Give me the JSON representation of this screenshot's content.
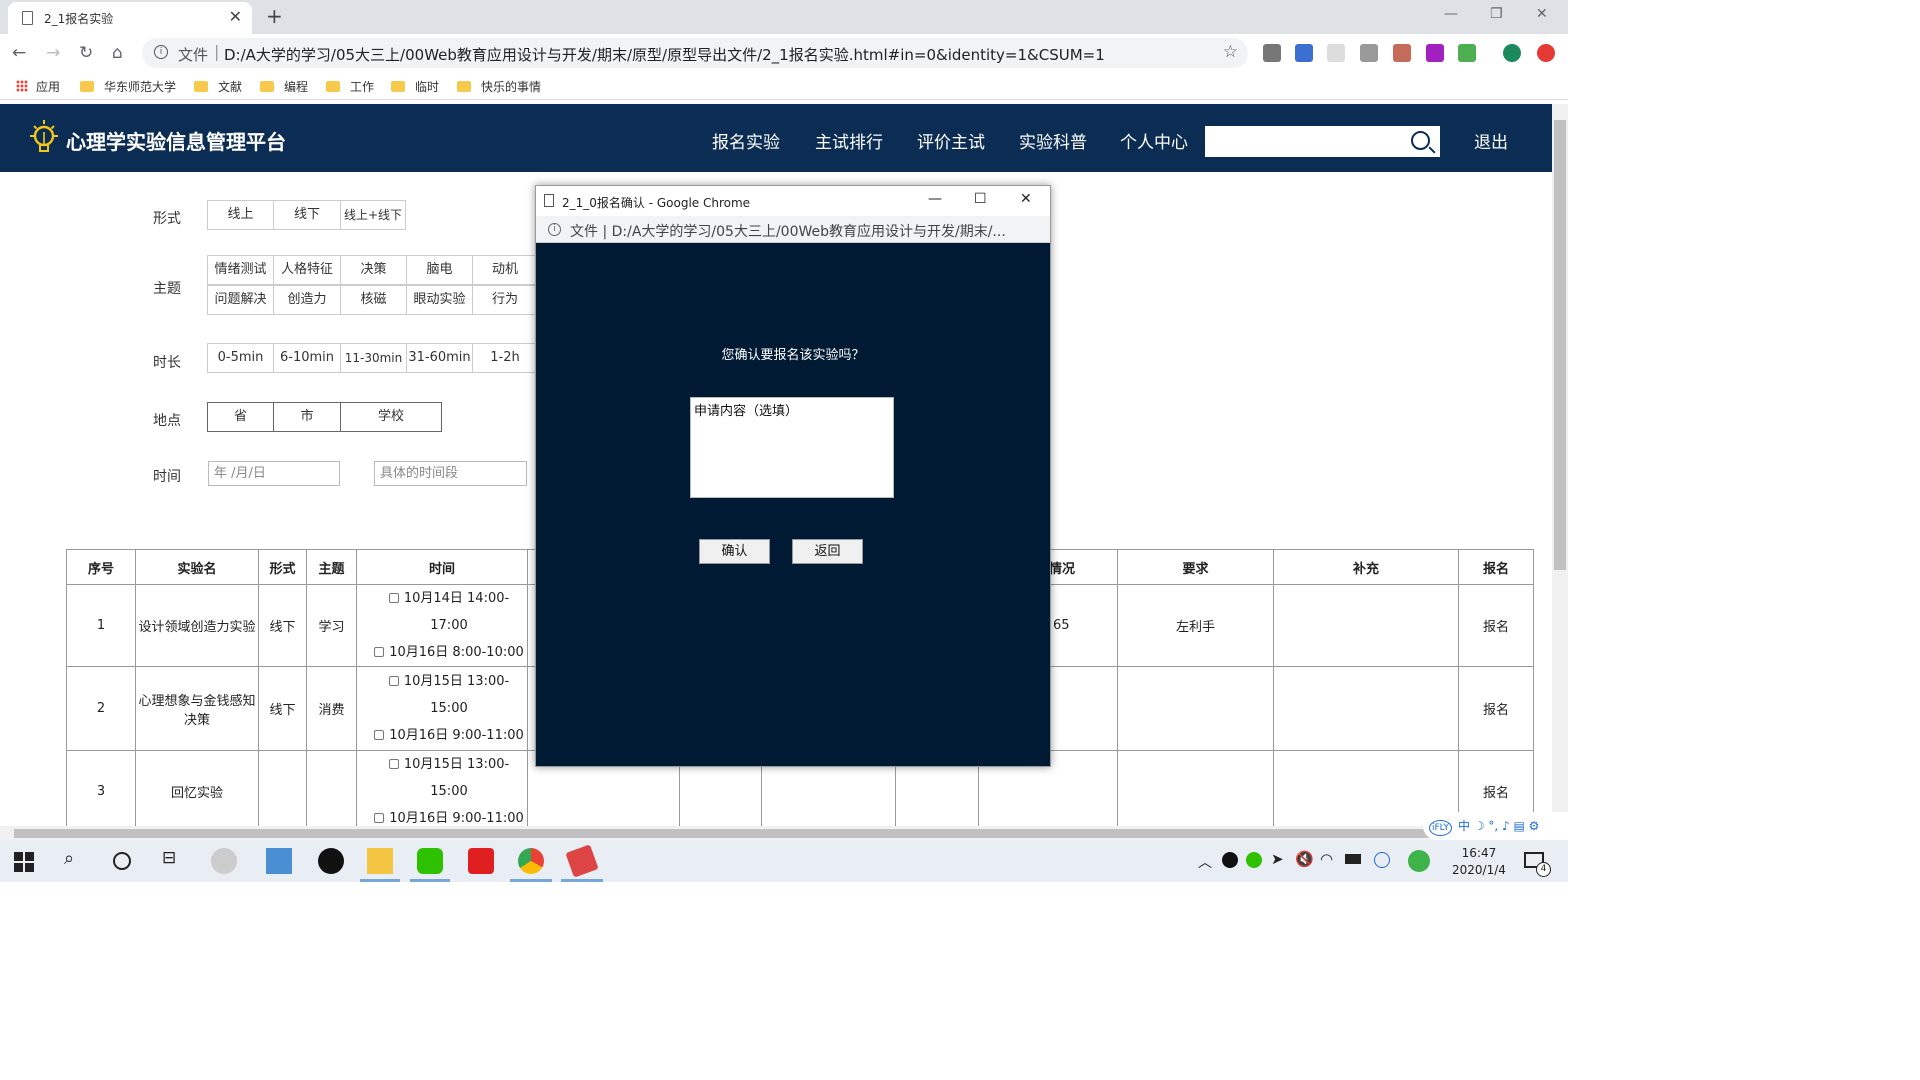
{
  "browser": {
    "tab_title": "2_1报名实验",
    "new_tab": "+",
    "url_prefix": "文件",
    "url": "D:/A大学的学习/05大三上/00Web教育应用设计与开发/期末/原型/原型导出文件/2_1报名实验.html#in=0&identity=1&CSUM=1",
    "bookmarks": [
      "应用",
      "华东师范大学",
      "文献",
      "编程",
      "工作",
      "临时",
      "快乐的事情"
    ]
  },
  "header": {
    "brand": "心理学实验信息管理平台",
    "nav": [
      "报名实验",
      "主试排行",
      "评价主试",
      "实验科普",
      "个人中心"
    ],
    "logout": "退出"
  },
  "filters": {
    "form_label": "形式",
    "form_opts": [
      "线上",
      "线下",
      "线上+线下"
    ],
    "theme_label": "主题",
    "theme_row1": [
      "情绪测试",
      "人格特征",
      "决策",
      "脑电",
      "动机"
    ],
    "theme_row2": [
      "问题解决",
      "创造力",
      "核磁",
      "眼动实验",
      "行为"
    ],
    "duration_label": "时长",
    "duration_opts": [
      "0-5min",
      "6-10min",
      "11-30min",
      "31-60min",
      "1-2h"
    ],
    "place_label": "地点",
    "place_opts": [
      "省",
      "市",
      "学校"
    ],
    "time_label": "时间",
    "date_placeholder": "年 /月/日",
    "period_placeholder": "具体的时间段"
  },
  "table": {
    "headers": {
      "no": "序号",
      "name": "实验名",
      "form": "形式",
      "theme": "主题",
      "time": "时间",
      "status": "情况",
      "req": "要求",
      "extra": "补充",
      "signup": "报名"
    },
    "rows": [
      {
        "no": "1",
        "name": "设计领域创造力实验",
        "form": "线下",
        "theme": "学习",
        "t1": "10月14日  14:00-17:00",
        "t2": "10月16日  8:00-10:00",
        "status": "65",
        "req": "左利手",
        "signup": "报名"
      },
      {
        "no": "2",
        "name": "心理想象与金钱感知决策",
        "form": "线下",
        "theme": "消费",
        "t1": "10月15日  13:00-15:00",
        "t2": "10月16日  9:00-11:00",
        "status": "",
        "req": "",
        "signup": "报名"
      },
      {
        "no": "3",
        "name": "回忆实验",
        "form": "",
        "theme": "",
        "t1": "10月15日  13:00-15:00",
        "t2": "10月16日  9:00-11:00",
        "status": "",
        "req": "",
        "signup": "报名"
      }
    ]
  },
  "popup": {
    "title": "2_1_0报名确认 - Google Chrome",
    "url_prefix": "文件",
    "url": "D:/A大学的学习/05大三上/00Web教育应用设计与开发/期末/...",
    "question": "您确认要报名该实验吗？",
    "textarea": "申请内容（选填）",
    "confirm": "确认",
    "back": "返回"
  },
  "taskbar": {
    "time": "16:47",
    "date": "2020/1/4",
    "notif_count": "4",
    "ime": "中 ☽ °, ♪ ▤ ⚙"
  },
  "colors": {
    "header_bg": "#0c2d53",
    "popup_bg": "#011a34"
  }
}
